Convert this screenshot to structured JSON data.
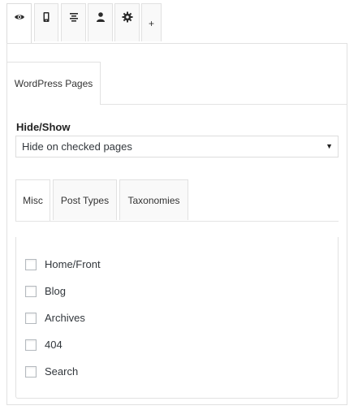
{
  "top_tabs": [
    {
      "name": "tab-visibility",
      "icon": "eye-icon"
    },
    {
      "name": "tab-devices",
      "icon": "mobile-icon"
    },
    {
      "name": "tab-alignment",
      "icon": "align-center-icon"
    },
    {
      "name": "tab-users",
      "icon": "user-icon"
    },
    {
      "name": "tab-settings",
      "icon": "gear-icon"
    },
    {
      "name": "tab-add",
      "icon": "plus-icon",
      "label": "+"
    }
  ],
  "section_tab": {
    "label": "WordPress Pages"
  },
  "hide_show": {
    "label": "Hide/Show",
    "selected": "Hide on checked pages"
  },
  "inner_tabs": [
    {
      "label": "Misc",
      "active": true
    },
    {
      "label": "Post Types",
      "active": false
    },
    {
      "label": "Taxonomies",
      "active": false
    }
  ],
  "checkboxes": [
    {
      "label": "Home/Front",
      "checked": false
    },
    {
      "label": "Blog",
      "checked": false
    },
    {
      "label": "Archives",
      "checked": false
    },
    {
      "label": "404",
      "checked": false
    },
    {
      "label": "Search",
      "checked": false
    }
  ]
}
